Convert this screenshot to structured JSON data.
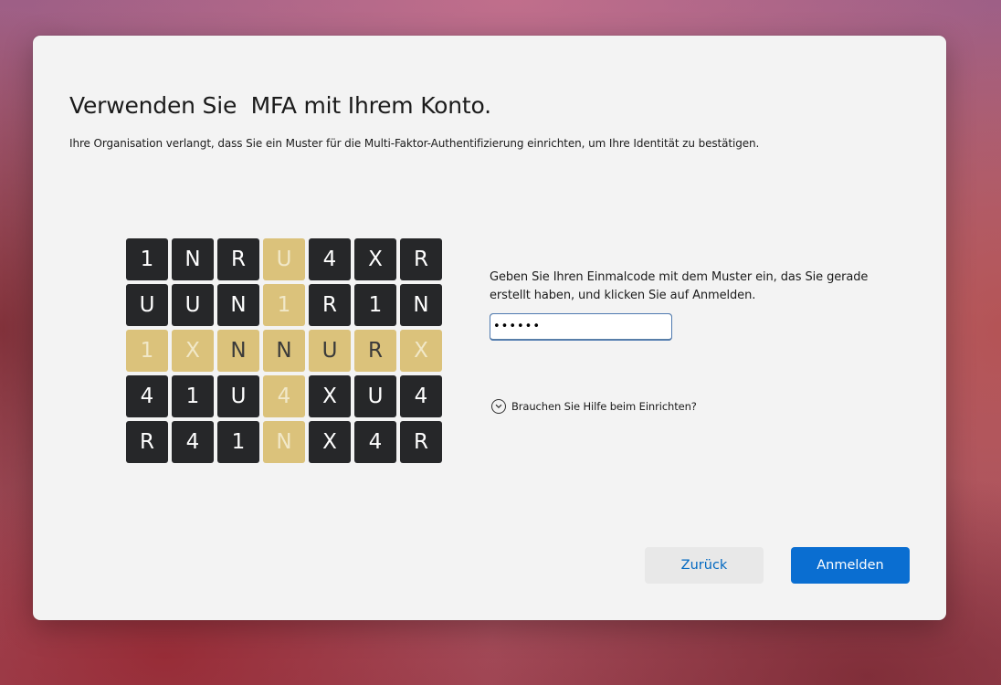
{
  "dialog": {
    "title": "Verwenden Sie  MFA mit Ihrem Konto.",
    "subtitle": "Ihre Organisation verlangt, dass Sie ein Muster für die Multi-Faktor-Authentifizierung einrichten, um Ihre Identität zu bestätigen."
  },
  "pattern_grid": {
    "rows": [
      [
        "1",
        "N",
        "R",
        "U",
        "4",
        "X",
        "R"
      ],
      [
        "U",
        "U",
        "N",
        "1",
        "R",
        "1",
        "N"
      ],
      [
        "1",
        "X",
        "N",
        "N",
        "U",
        "R",
        "X"
      ],
      [
        "4",
        "1",
        "U",
        "4",
        "X",
        "U",
        "4"
      ],
      [
        "R",
        "4",
        "1",
        "N",
        "X",
        "4",
        "R"
      ]
    ],
    "highlight_color": "#dbc27b",
    "cell_color": "#262729"
  },
  "code_entry": {
    "instructions": "Geben Sie Ihren Einmalcode mit dem Muster ein, das Sie gerade erstellt haben, und klicken Sie auf Anmelden.",
    "value": "••••••"
  },
  "help": {
    "icon": "chevron-down-circle-icon",
    "label": "Brauchen Sie Hilfe beim Einrichten?"
  },
  "buttons": {
    "back_label": "Zurück",
    "signin_label": "Anmelden",
    "accent_color": "#0a6ed1"
  }
}
